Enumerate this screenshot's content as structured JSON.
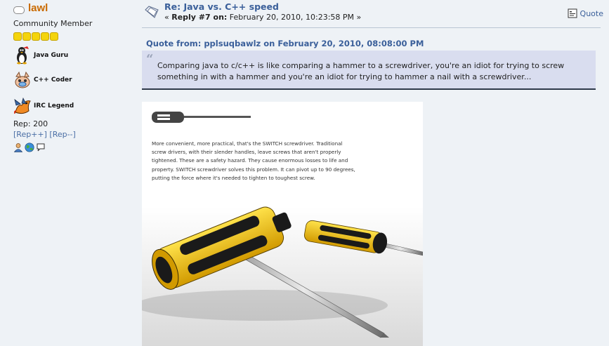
{
  "poster": {
    "name": "lawl",
    "group": "Community Member",
    "star_count": 5,
    "badges": [
      {
        "label": "Java Guru",
        "icon": "penguin-icon"
      },
      {
        "label": "C++ Coder",
        "icon": "creature-icon"
      },
      {
        "label": "IRC Legend",
        "icon": "dragon-icon"
      }
    ],
    "rep": "Rep: 200",
    "rep_plus": "[Rep++]",
    "rep_minus": "[Rep--]"
  },
  "post": {
    "title": "Re: Java vs. C++ speed",
    "meta_prefix": "« ",
    "meta_reply": "Reply #7 on:",
    "meta_date": " February 20, 2010, 10:23:58 PM »",
    "quote_button": "Quote",
    "quote_header": "Quote from: pplsuqbawlz on February 20, 2010, 08:08:00 PM",
    "quote_body": "Comparing java to c/c++ is like comparing a hammer to a screwdriver, you're an idiot for trying to screw something in with a hammer and you're an idiot for trying to hammer a nail with a screwdriver...",
    "image_text": "More convenient, more practical, that's the SWITCH screwdriver.  Traditional screw drivers, with their slender handles, leave screws that aren't properly tightened.  These are a safety hazard.  They cause enormous losses to life and property.  SWITCH screwdriver solves this problem.  It can pivot up to 90 degrees, putting the force where it's needed to tighten to toughest screw.",
    "image_brand": "SWITCH"
  },
  "colors": {
    "name": "#c96a00",
    "link": "#3a5f9a",
    "quote_bg": "#d9ddef",
    "page_bg": "#eef2f6"
  }
}
